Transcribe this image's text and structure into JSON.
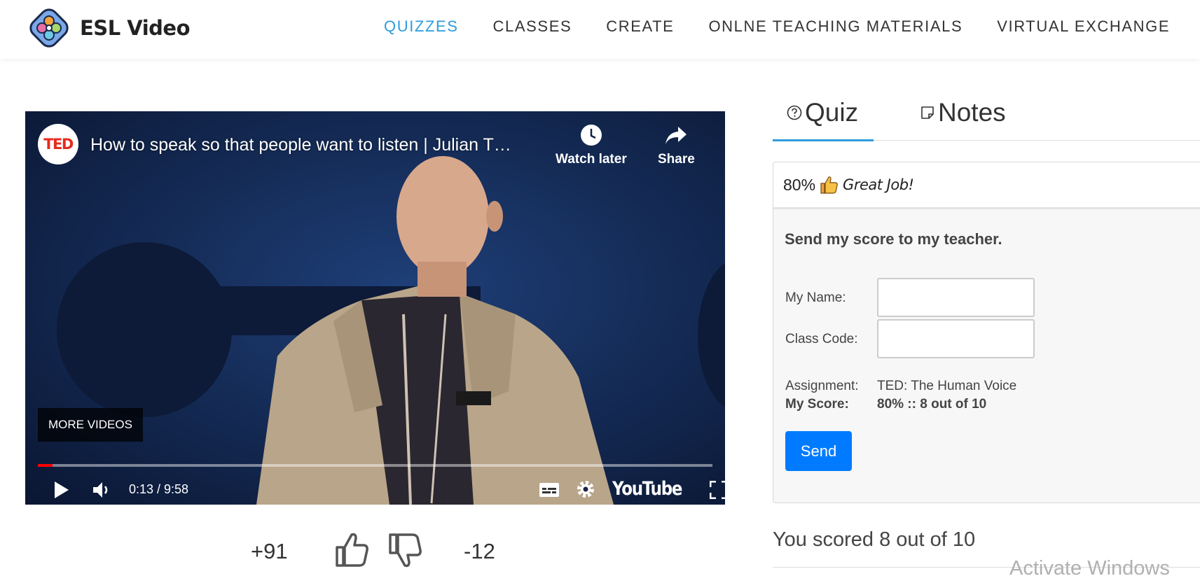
{
  "site": {
    "logo_text": "ESL Video"
  },
  "nav": {
    "items": [
      {
        "label": "QUIZZES",
        "active": true
      },
      {
        "label": "CLASSES",
        "active": false
      },
      {
        "label": "CREATE",
        "active": false
      },
      {
        "label": "ONLNE TEACHING MATERIALS",
        "active": false
      },
      {
        "label": "VIRTUAL EXCHANGE",
        "active": false
      }
    ]
  },
  "video": {
    "channel_logo_text": "TED",
    "title": "How to speak so that people want to listen | Julian T…",
    "watch_later_label": "Watch later",
    "share_label": "Share",
    "more_videos_label": "MORE VIDEOS",
    "time_display": "0:13 / 9:58",
    "progress_fraction": 0.022,
    "youtube_wordmark": "YouTube"
  },
  "votes": {
    "up": "+91",
    "down": "-12"
  },
  "tabs": [
    {
      "label": "Quiz",
      "active": true
    },
    {
      "label": "Notes",
      "active": false
    }
  ],
  "score_card": {
    "percent": "80%",
    "message": "Great Job!",
    "send_title": "Send my score to my teacher.",
    "name_label": "My Name:",
    "name_value": "",
    "class_code_label": "Class Code:",
    "class_code_value": "",
    "assignment_label": "Assignment:",
    "assignment_value": "TED: The Human Voice",
    "my_score_label": "My Score:",
    "my_score_value": "80% :: 8 out of 10",
    "send_label": "Send"
  },
  "result_text": "You scored 8 out of 10",
  "os_watermark": "Activate Windows",
  "colors": {
    "accent": "#2d9cdb",
    "send_button": "#007bff",
    "youtube_progress": "#ff0000",
    "ted_red": "#e62b1e"
  }
}
